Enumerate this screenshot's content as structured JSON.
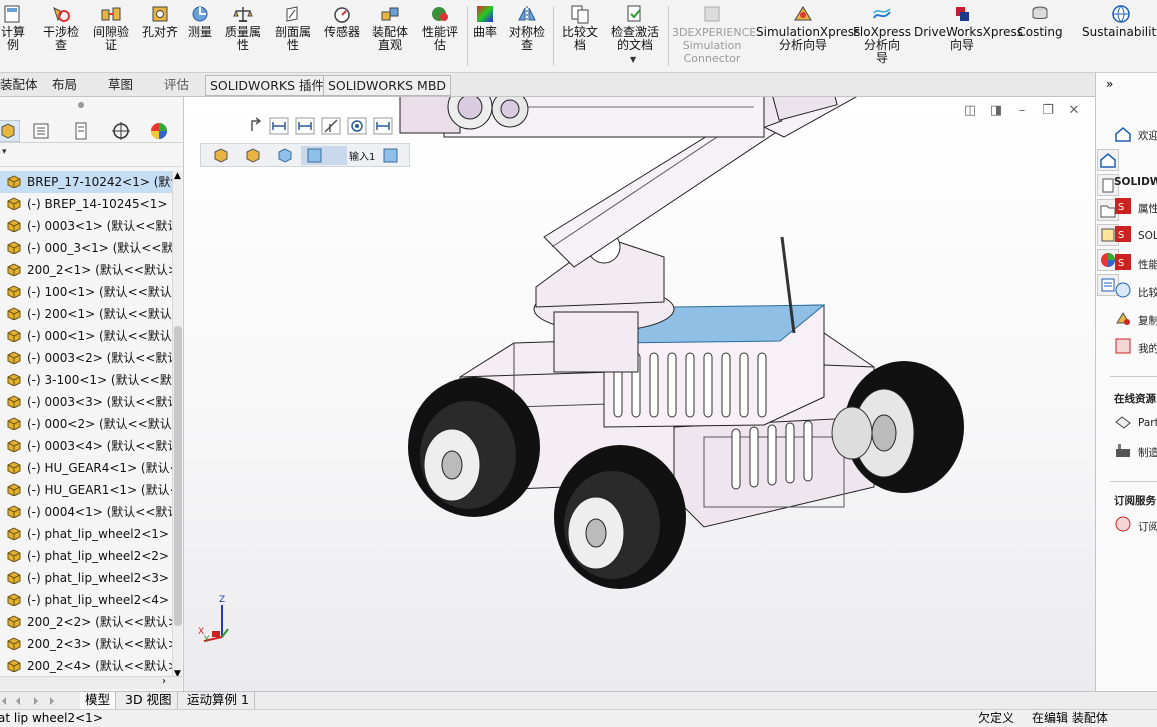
{
  "ribbon": {
    "tools": [
      {
        "id": "calc",
        "label": "计算\n例"
      },
      {
        "id": "interference",
        "label": "干涉检\n查"
      },
      {
        "id": "clearance",
        "label": "间隙验\n证"
      },
      {
        "id": "hole-align",
        "label": "孔对齐"
      },
      {
        "id": "measure",
        "label": "测量"
      },
      {
        "id": "mass-props",
        "label": "质量属\n性"
      },
      {
        "id": "section-props",
        "label": "剖面属\n性"
      },
      {
        "id": "sensor",
        "label": "传感器"
      },
      {
        "id": "assembly-visual",
        "label": "装配体\n直观"
      },
      {
        "id": "performance",
        "label": "性能评\n估"
      },
      {
        "id": "curvature",
        "label": "曲率"
      },
      {
        "id": "symmetry",
        "label": "对称检\n查"
      },
      {
        "id": "compare",
        "label": "比较文\n档"
      },
      {
        "id": "check-active",
        "label": "检查激活\n的文档"
      },
      {
        "id": "3dx",
        "label": "3DEXPERIENCE\nSimulation\nConnector"
      },
      {
        "id": "simxpress",
        "label": "SimulationXpress\n分析向导"
      },
      {
        "id": "floxpress",
        "label": "FloXpress\n分析向\n导"
      },
      {
        "id": "driveworks",
        "label": "DriveWorksXpress\n向导"
      },
      {
        "id": "costing",
        "label": "Costing"
      },
      {
        "id": "sustainability",
        "label": "Sustainability"
      }
    ]
  },
  "tabs": [
    "装配体",
    "布局",
    "草图",
    "评估",
    "SOLIDWORKS 插件",
    "SOLIDWORKS MBD"
  ],
  "tree": {
    "items": [
      "BREP_17-10242<1> (默认",
      "(-) BREP_14-10245<1> (",
      "(-) 0003<1> (默认<<默认",
      "(-) 000_3<1> (默认<<默认",
      "200_2<1> (默认<<默认>",
      "(-) 100<1> (默认<<默认>",
      "(-) 200<1> (默认<<默认>",
      "(-) 000<1> (默认<<默认>",
      "(-) 0003<2> (默认<<默认",
      "(-) 3-100<1> (默认<<默认",
      "(-) 0003<3> (默认<<默认",
      "(-) 000<2> (默认<<默认>",
      "(-) 0003<4> (默认<<默认",
      "(-) HU_GEAR4<1> (默认<",
      "(-) HU_GEAR1<1> (默认<",
      "(-) 0004<1> (默认<<默认",
      "(-) phat_lip_wheel2<1> (",
      "(-) phat_lip_wheel2<2> (",
      "(-) phat_lip_wheel2<3> (",
      "(-) phat_lip_wheel2<4> (",
      "200_2<2> (默认<<默认>",
      "200_2<3> (默认<<默认>",
      "200_2<4> (默认<<默认>"
    ]
  },
  "viewport": {
    "breadcrumb_label": "输入1",
    "triad": {
      "z": "Z",
      "x": "X",
      "y": "Y"
    }
  },
  "taskpane": {
    "welcome": "欢迎",
    "sw_section": "SOLIDWO",
    "links": [
      "属性",
      "SOL",
      "性能",
      "比较",
      "复制",
      "我的"
    ],
    "online_title": "在线资源",
    "online_links": [
      "Part",
      "制造"
    ],
    "sub_title": "订阅服务",
    "sub_links": [
      "订阅"
    ]
  },
  "bottom_tabs": [
    "模型",
    "3D 视图",
    "运动算例 1"
  ],
  "status": {
    "left": "at lip wheel2<1>",
    "undefined": "欠定义",
    "editing": "在编辑 装配体"
  },
  "colors": {
    "tree_selected": "#c6def3",
    "accent_blue": "#1e5fb4",
    "part_yellow": "#e3b12e"
  }
}
